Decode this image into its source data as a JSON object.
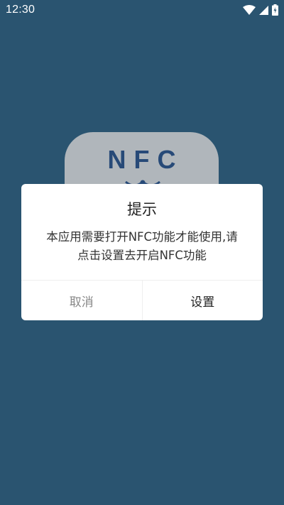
{
  "status_bar": {
    "time": "12:30",
    "icons": [
      "wifi-icon",
      "cell-signal-icon",
      "battery-charging-icon"
    ]
  },
  "app": {
    "logo_text": "NFC"
  },
  "dialog": {
    "title": "提示",
    "message_line1": "本应用需要打开NFC功能才能使用,请",
    "message_line2": "点击设置去开启NFC功能",
    "cancel_label": "取消",
    "confirm_label": "设置"
  },
  "colors": {
    "background": "#2a5470",
    "logo_bg": "#b0b6bb",
    "logo_text": "#274a78",
    "dialog_bg": "#ffffff"
  }
}
